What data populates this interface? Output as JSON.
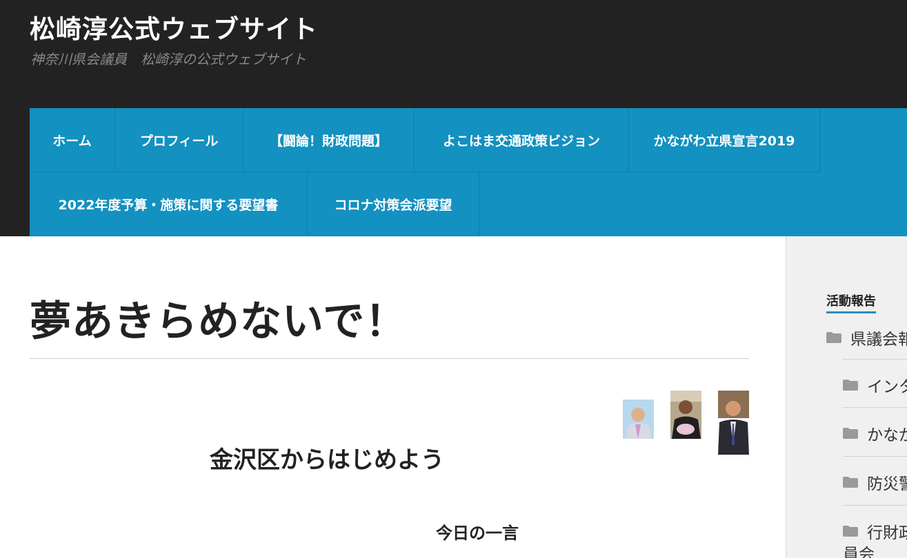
{
  "site": {
    "title": "松崎淳公式ウェブサイト",
    "description": "神奈川県会議員　松崎淳の公式ウェブサイト"
  },
  "nav": {
    "items": [
      {
        "label": "ホーム"
      },
      {
        "label": "プロフィール"
      },
      {
        "label": "【闘論！財政問題】"
      },
      {
        "label": "よこはま交通政策ビジョン"
      },
      {
        "label": "かながわ立県宣言2019"
      },
      {
        "label": "2022年度予算・施策に関する要望書"
      },
      {
        "label": "コロナ対策会派要望"
      }
    ]
  },
  "post": {
    "title": "夢あきらめないで！",
    "heading": "金沢区からはじめよう",
    "subheading": "今日の一言"
  },
  "sidebar": {
    "widget_title": "活動報告",
    "categories": [
      {
        "label": "県議会報",
        "icon": "folder-icon"
      },
      {
        "label": "インタ",
        "icon": "folder-icon"
      },
      {
        "label": "かなが",
        "icon": "folder-icon"
      },
      {
        "label": "防災警",
        "icon": "folder-icon"
      },
      {
        "label": "行財政",
        "icon": "folder-icon"
      },
      {
        "label": "員会",
        "icon": "folder-icon"
      }
    ]
  },
  "colors": {
    "header_bg": "#222222",
    "nav_bg": "#1391c0",
    "accent": "#1391c0",
    "sidebar_bg": "#f0f0f0"
  }
}
